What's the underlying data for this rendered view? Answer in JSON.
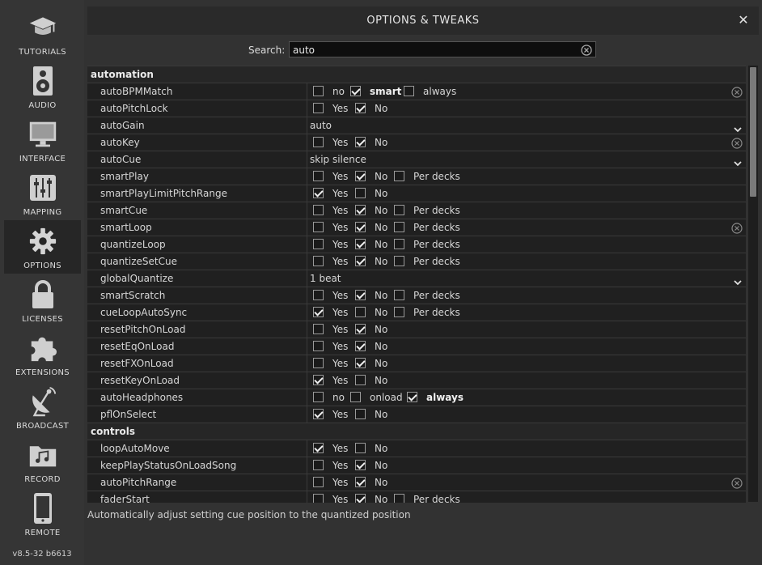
{
  "sidebar": {
    "items": [
      {
        "label": "TUTORIALS",
        "icon": "graduation-cap-icon"
      },
      {
        "label": "AUDIO",
        "icon": "speaker-icon"
      },
      {
        "label": "INTERFACE",
        "icon": "monitor-icon"
      },
      {
        "label": "MAPPING",
        "icon": "sliders-icon"
      },
      {
        "label": "OPTIONS",
        "icon": "gear-icon",
        "active": true
      },
      {
        "label": "LICENSES",
        "icon": "lock-icon"
      },
      {
        "label": "EXTENSIONS",
        "icon": "puzzle-icon"
      },
      {
        "label": "BROADCAST",
        "icon": "satellite-dish-icon"
      },
      {
        "label": "RECORD",
        "icon": "music-folder-icon"
      },
      {
        "label": "REMOTE",
        "icon": "phone-icon"
      }
    ],
    "version": "v8.5-32 b6613"
  },
  "dialog": {
    "title": "OPTIONS & TWEAKS"
  },
  "search": {
    "label": "Search:",
    "value": "auto"
  },
  "options": [
    {
      "section": "automation"
    },
    {
      "name": "autoBPMMatch",
      "type": "checks",
      "opts": [
        {
          "l": "no",
          "c": false
        },
        {
          "l": "smart",
          "c": true,
          "b": true
        },
        {
          "l": "always",
          "c": false
        }
      ],
      "reset": true
    },
    {
      "name": "autoPitchLock",
      "type": "checks",
      "opts": [
        {
          "l": "Yes",
          "c": false
        },
        {
          "l": "No",
          "c": true
        }
      ]
    },
    {
      "name": "autoGain",
      "type": "dropdown",
      "value": "auto"
    },
    {
      "name": "autoKey",
      "type": "checks",
      "opts": [
        {
          "l": "Yes",
          "c": false
        },
        {
          "l": "No",
          "c": true
        }
      ],
      "reset": true
    },
    {
      "name": "autoCue",
      "type": "dropdown",
      "value": "skip silence"
    },
    {
      "name": "smartPlay",
      "type": "checks",
      "opts": [
        {
          "l": "Yes",
          "c": false
        },
        {
          "l": "No",
          "c": true
        },
        {
          "l": "Per decks",
          "c": false
        }
      ]
    },
    {
      "name": "smartPlayLimitPitchRange",
      "type": "checks",
      "opts": [
        {
          "l": "Yes",
          "c": true
        },
        {
          "l": "No",
          "c": false
        }
      ]
    },
    {
      "name": "smartCue",
      "type": "checks",
      "opts": [
        {
          "l": "Yes",
          "c": false
        },
        {
          "l": "No",
          "c": true
        },
        {
          "l": "Per decks",
          "c": false
        }
      ]
    },
    {
      "name": "smartLoop",
      "type": "checks",
      "opts": [
        {
          "l": "Yes",
          "c": false
        },
        {
          "l": "No",
          "c": true
        },
        {
          "l": "Per decks",
          "c": false
        }
      ],
      "reset": true
    },
    {
      "name": "quantizeLoop",
      "type": "checks",
      "opts": [
        {
          "l": "Yes",
          "c": false
        },
        {
          "l": "No",
          "c": true
        },
        {
          "l": "Per decks",
          "c": false
        }
      ]
    },
    {
      "name": "quantizeSetCue",
      "type": "checks",
      "opts": [
        {
          "l": "Yes",
          "c": false
        },
        {
          "l": "No",
          "c": true
        },
        {
          "l": "Per decks",
          "c": false
        }
      ]
    },
    {
      "name": "globalQuantize",
      "type": "dropdown",
      "value": "1 beat"
    },
    {
      "name": "smartScratch",
      "type": "checks",
      "opts": [
        {
          "l": "Yes",
          "c": false
        },
        {
          "l": "No",
          "c": true
        },
        {
          "l": "Per decks",
          "c": false
        }
      ]
    },
    {
      "name": "cueLoopAutoSync",
      "type": "checks",
      "opts": [
        {
          "l": "Yes",
          "c": true
        },
        {
          "l": "No",
          "c": false
        },
        {
          "l": "Per decks",
          "c": false
        }
      ]
    },
    {
      "name": "resetPitchOnLoad",
      "type": "checks",
      "opts": [
        {
          "l": "Yes",
          "c": false
        },
        {
          "l": "No",
          "c": true
        }
      ]
    },
    {
      "name": "resetEqOnLoad",
      "type": "checks",
      "opts": [
        {
          "l": "Yes",
          "c": false
        },
        {
          "l": "No",
          "c": true
        }
      ]
    },
    {
      "name": "resetFXOnLoad",
      "type": "checks",
      "opts": [
        {
          "l": "Yes",
          "c": false
        },
        {
          "l": "No",
          "c": true
        }
      ]
    },
    {
      "name": "resetKeyOnLoad",
      "type": "checks",
      "opts": [
        {
          "l": "Yes",
          "c": true
        },
        {
          "l": "No",
          "c": false
        }
      ]
    },
    {
      "name": "autoHeadphones",
      "type": "checks",
      "opts": [
        {
          "l": "no",
          "c": false
        },
        {
          "l": "onload",
          "c": false
        },
        {
          "l": "always",
          "c": true,
          "b": true
        }
      ]
    },
    {
      "name": "pflOnSelect",
      "type": "checks",
      "opts": [
        {
          "l": "Yes",
          "c": true
        },
        {
          "l": "No",
          "c": false
        }
      ]
    },
    {
      "section": "controls"
    },
    {
      "name": "loopAutoMove",
      "type": "checks",
      "opts": [
        {
          "l": "Yes",
          "c": true
        },
        {
          "l": "No",
          "c": false
        }
      ]
    },
    {
      "name": "keepPlayStatusOnLoadSong",
      "type": "checks",
      "opts": [
        {
          "l": "Yes",
          "c": false
        },
        {
          "l": "No",
          "c": true
        }
      ]
    },
    {
      "name": "autoPitchRange",
      "type": "checks",
      "opts": [
        {
          "l": "Yes",
          "c": false
        },
        {
          "l": "No",
          "c": true
        }
      ],
      "reset": true
    },
    {
      "name": "faderStart",
      "type": "checks",
      "opts": [
        {
          "l": "Yes",
          "c": false
        },
        {
          "l": "No",
          "c": true
        },
        {
          "l": "Per decks",
          "c": false
        }
      ]
    }
  ],
  "description": "Automatically adjust setting cue position to the quantized position"
}
